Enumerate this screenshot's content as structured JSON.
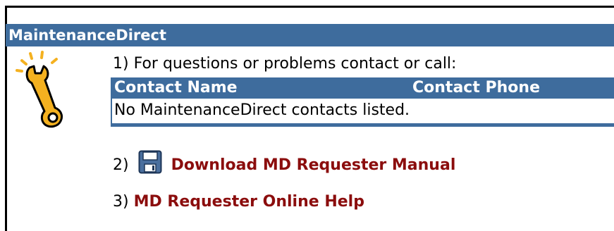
{
  "panel": {
    "title": "MaintenanceDirect"
  },
  "contact_section": {
    "instruction": "1) For questions or problems contact or call:",
    "table": {
      "columns": [
        "Contact Name",
        "Contact Phone"
      ],
      "empty_message": "No MaintenanceDirect contacts listed."
    }
  },
  "links": {
    "download_number": "2)",
    "download_label": "Download MD Requester Manual",
    "download_icon": "floppy-disk-icon",
    "help_number": "3)",
    "help_label": "MD Requester Online Help"
  },
  "icons": {
    "panel_icon": "wrench-icon"
  },
  "colors": {
    "header_bg": "#3e6c9d",
    "link": "#8b0d0d",
    "icon_gold": "#f4b120"
  }
}
